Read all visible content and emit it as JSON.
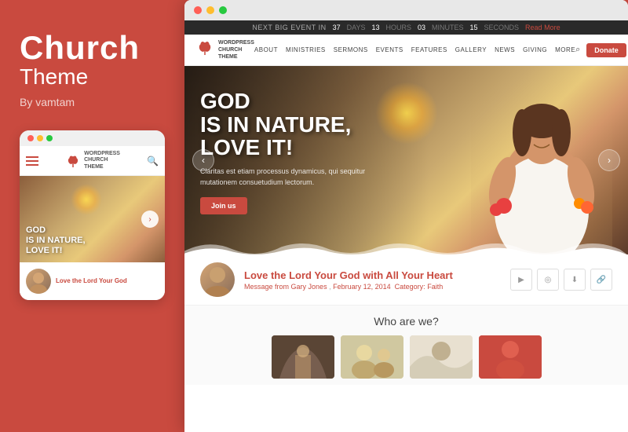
{
  "left": {
    "title_main": "Church",
    "title_sub": "Theme",
    "author": "By vamtam"
  },
  "mobile": {
    "logo_line1": "WORDPRESS",
    "logo_line2": "CHURCH",
    "logo_line3": "THEME",
    "hero_text_line1": "GOD",
    "hero_text_line2": "IS IN NATURE,",
    "hero_text_line3": "LOVE IT!",
    "sermon_title": "Love the Lord Your God"
  },
  "browser": {
    "dots": [
      "red",
      "yellow",
      "green"
    ]
  },
  "topbar": {
    "event_label": "NEXT BIG EVENT IN",
    "days_val": "37",
    "days_label": "DAYS",
    "hours_val": "13",
    "hours_label": "HOURS",
    "minutes_val": "03",
    "minutes_label": "MINUTES",
    "seconds_val": "15",
    "seconds_label": "SECONDS",
    "read_more": "Read More"
  },
  "nav": {
    "logo_line1": "WORDPRESS",
    "logo_line2": "CHURCH",
    "logo_line3": "THEME",
    "links": [
      "ABOUT",
      "MINISTRIES",
      "SERMONS",
      "EVENTS",
      "FEATURES",
      "GALLERY",
      "NEWS",
      "GIVING",
      "MORE"
    ],
    "donate_btn": "Donate"
  },
  "hero": {
    "title_line1": "GOD",
    "title_line2": "IS IN NATURE,",
    "title_line3": "LOVE IT!",
    "subtitle": "Claritas est etiam processus dynamicus, qui sequitur mutationem consuetudium lectorum.",
    "cta_btn": "Join us"
  },
  "sermon": {
    "title": "Love the Lord Your God with All Your Heart",
    "meta_prefix": "Message from",
    "meta_author": "Gary Jones",
    "meta_date": "February 12, 2014",
    "meta_category_label": "Category:",
    "meta_category": "Faith",
    "actions": [
      "▶",
      "🎧",
      "⬇",
      "🔗"
    ]
  },
  "who_section": {
    "title": "Who are we?"
  }
}
